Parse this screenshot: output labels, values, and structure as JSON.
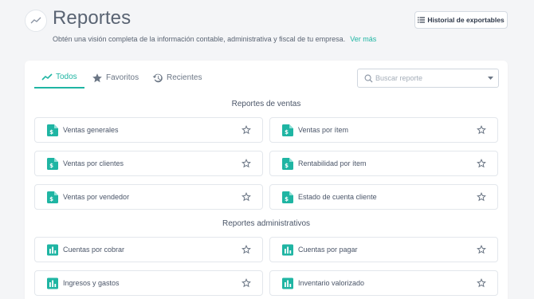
{
  "header": {
    "title": "Reportes",
    "subtitle": "Obtén una visión completa de la información contable, administrativa y fiscal de tu empresa.",
    "see_more": "Ver más",
    "export_button": "Historial de exportables"
  },
  "tabs": [
    {
      "label": "Todos",
      "icon": "trend-icon",
      "active": true
    },
    {
      "label": "Favoritos",
      "icon": "star-icon",
      "active": false
    },
    {
      "label": "Recientes",
      "icon": "history-icon",
      "active": false
    }
  ],
  "search": {
    "placeholder": "Buscar reporte",
    "value": ""
  },
  "sections": [
    {
      "title": "Reportes de ventas",
      "icon": "document-dollar-icon",
      "items": [
        "Ventas generales",
        "Ventas por ítem",
        "Ventas por clientes",
        "Rentabilidad por ítem",
        "Ventas por vendedor",
        "Estado de cuenta cliente"
      ]
    },
    {
      "title": "Reportes administrativos",
      "icon": "bar-chart-icon",
      "items": [
        "Cuentas por cobrar",
        "Cuentas por pagar",
        "Ingresos y gastos",
        "Inventario valorizado"
      ]
    }
  ],
  "colors": {
    "accent": "#1fb5a3",
    "text": "#4a5568",
    "border": "#e3e7ec",
    "background": "#f4f5f7"
  }
}
